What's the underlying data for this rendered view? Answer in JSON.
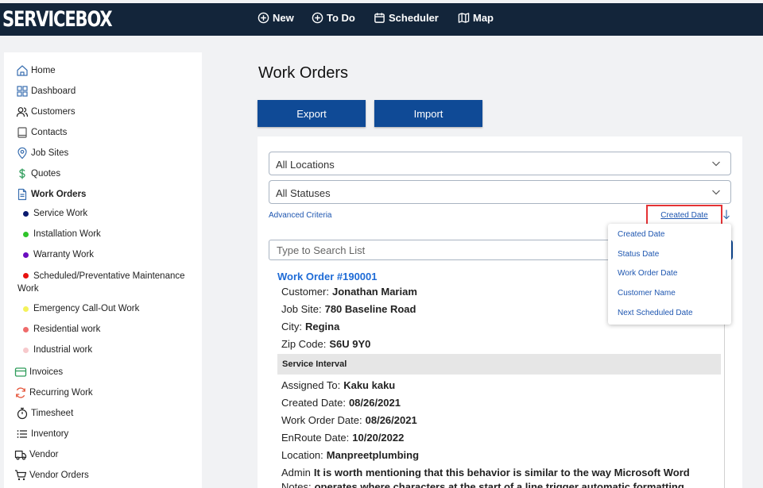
{
  "app": {
    "logo": "SERVICEBOX"
  },
  "topnav": [
    {
      "label": "New",
      "icon": "plus-circle-icon"
    },
    {
      "label": "To Do",
      "icon": "plus-circle-icon"
    },
    {
      "label": "Scheduler",
      "icon": "calendar-icon"
    },
    {
      "label": "Map",
      "icon": "map-icon"
    }
  ],
  "sidebar": {
    "items": [
      {
        "label": "Home",
        "icon": "home-icon"
      },
      {
        "label": "Dashboard",
        "icon": "grid-icon"
      },
      {
        "label": "Customers",
        "icon": "users-icon"
      },
      {
        "label": "Contacts",
        "icon": "book-icon"
      },
      {
        "label": "Job Sites",
        "icon": "map-pin-icon"
      },
      {
        "label": "Quotes",
        "icon": "dollar-icon"
      },
      {
        "label": "Work Orders",
        "icon": "document-icon"
      }
    ],
    "sub_items": [
      {
        "label": "Service Work",
        "color": "#0a1a6e"
      },
      {
        "label": "Installation Work",
        "color": "#2ec42a"
      },
      {
        "label": "Warranty Work",
        "color": "#6a0dbf"
      },
      {
        "label": "Scheduled/Preventative Maintenance Work",
        "color": "#e8110f"
      },
      {
        "label": "Emergency Call-Out Work",
        "color": "#f4f25a"
      },
      {
        "label": "Residential work",
        "color": "#ef6b6b"
      },
      {
        "label": "Industrial work",
        "color": "#f7c9cc"
      }
    ],
    "items_after": [
      {
        "label": "Invoices",
        "icon": "card-icon"
      },
      {
        "label": "Recurring Work",
        "icon": "refresh-icon"
      },
      {
        "label": "Timesheet",
        "icon": "stopwatch-icon"
      },
      {
        "label": "Inventory",
        "icon": "list-icon"
      },
      {
        "label": "Vendor",
        "icon": "truck-icon"
      },
      {
        "label": "Vendor Orders",
        "icon": "cart-icon"
      }
    ]
  },
  "main": {
    "title": "Work Orders",
    "export_label": "Export",
    "import_label": "Import",
    "location_select": "All Locations",
    "status_select": "All Statuses",
    "advanced_criteria": "Advanced Criteria",
    "sort_by": "Created Date",
    "search_placeholder": "Type to Search List"
  },
  "sort_options": [
    "Created Date",
    "Status Date",
    "Work Order Date",
    "Customer Name",
    "Next Scheduled Date"
  ],
  "work_order": {
    "title": "Work Order #190001",
    "customer_label": "Customer:",
    "customer": "Jonathan Mariam",
    "job_site_label": "Job Site:",
    "job_site": "780 Baseline Road",
    "city_label": "City:",
    "city": "Regina",
    "zip_label": "Zip Code:",
    "zip": "S6U 9Y0",
    "interval_header": "Service Interval",
    "assigned_label": "Assigned To:",
    "assigned": "Kaku kaku",
    "created_label": "Created Date:",
    "created": "08/26/2021",
    "wo_date_label": "Work Order Date:",
    "wo_date": "08/26/2021",
    "enroute_label": "EnRoute Date:",
    "enroute": "10/20/2022",
    "location_label": "Location:",
    "location": "Manpreetplumbing",
    "admin_notes_label": "Admin",
    "admin_notes": "It is worth mentioning that this behavior is similar to the way Microsoft Word",
    "notes_label": "Notes:",
    "notes": "operates where characters at the start of a line trigger automatic formatting"
  }
}
